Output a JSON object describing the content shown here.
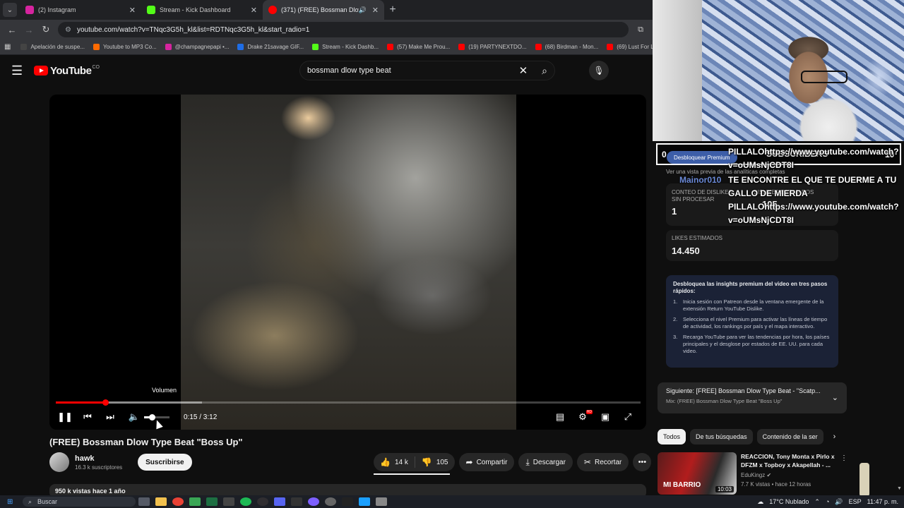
{
  "browser": {
    "tabs": [
      {
        "title": "(2) Instagram",
        "favicon_color": "#d6249f",
        "active": false
      },
      {
        "title": "Stream - Kick Dashboard",
        "favicon_color": "#53fc18",
        "active": false
      },
      {
        "title": "(371) (FREE) Bossman Dlow",
        "favicon_color": "#ff0000",
        "active": true
      }
    ],
    "url": "youtube.com/watch?v=TNqc3G5h_kl&list=RDTNqc3G5h_kl&start_radio=1",
    "bookmarks": [
      {
        "label": "Apelación de suspe...",
        "color": "#444444"
      },
      {
        "label": "Youtube to MP3 Co...",
        "color": "#ff6a00"
      },
      {
        "label": "@champagnepapi •...",
        "color": "#d6249f"
      },
      {
        "label": "Drake 21savage GIF...",
        "color": "#1e6de6"
      },
      {
        "label": "Stream - Kick Dashb...",
        "color": "#53fc18"
      },
      {
        "label": "(57) Make Me Prou...",
        "color": "#ff0000"
      },
      {
        "label": "(19) PARTYNEXTDO...",
        "color": "#ff0000"
      },
      {
        "label": "(68) Birdman - Mon...",
        "color": "#ff0000"
      },
      {
        "label": "(69) Lust For L",
        "color": "#ff0000"
      }
    ]
  },
  "youtube": {
    "logo_text": "YouTube",
    "logo_country": "CO",
    "search_value": "bossman dlow type beat"
  },
  "player": {
    "tooltip": "Volumen",
    "time": "0:15 / 3:12",
    "progress": 0.085,
    "buffered": 0.25,
    "volume": 0.3
  },
  "video": {
    "title": "(FREE) Bossman Dlow Type Beat \"Boss Up\"",
    "channel": "hawk",
    "subscribers": "16.3 k suscriptores",
    "subscribe_label": "Suscribirse",
    "likes": "14 k",
    "dislikes": "105",
    "share_label": "Compartir",
    "download_label": "Descargar",
    "clip_label": "Recortar",
    "description_preview": "950 k vistas  hace 1 año"
  },
  "overlay": {
    "sub_count_left": "0",
    "sub_label": "SUBSCRIBERS",
    "sub_count_right": "10",
    "premium_button": "Desbloquear Premium",
    "preview_note": "Ver una vista previa de las analíticas completas",
    "chat_user": "Mainor010",
    "chat_line_1a": "PILLALOhttps://www.youtube.com/watch?",
    "chat_line_1b": "v=oUMsNjCDT8I",
    "chat_line_2a": "TE ENCONTRE EL QUE TE DUERME A TU",
    "chat_line_2b": "GALLO DE MIERDA",
    "chat_line_2c": "PILLALOhttps://www.youtube.com/watch?",
    "chat_line_2d": "v=oUMsNjCDT8I"
  },
  "rydl": {
    "raw_dislikes_label": "CONTEO DE DISLIKES SIN PROCESAR",
    "raw_dislikes_value": "1",
    "est_dislikes_label": "DISLIKES ESTIMADOS",
    "est_dislikes_value": "105",
    "est_likes_label": "LIKES ESTIMADOS",
    "est_likes_value": "14.450",
    "insights_title": "Desbloquea las insights premium del video en tres pasos rápidos:",
    "steps": [
      {
        "n": "1.",
        "text": "Inicia sesión con Patreon desde la ventana emergente de la extensión Return YouTube Dislike."
      },
      {
        "n": "2.",
        "text": "Selecciona el nivel Premium para activar las líneas de tiempo de actividad, los rankings por país y el mapa interactivo."
      },
      {
        "n": "3.",
        "text": "Recarga YouTube para ver las tendencias por hora, los países principales y el desglose por estados de EE. UU. para cada video."
      }
    ]
  },
  "next": {
    "title": "Siguiente: [FREE] Bossman Dlow Type Beat - \"Scatp...",
    "subtitle": "Mix: (FREE) Bossman Dlow Type Beat \"Boss Up\""
  },
  "chips": [
    "Todos",
    "De tus búsquedas",
    "Contenido de la ser"
  ],
  "recommendation": {
    "title": "REACCION, Tony Monta x Pirlo x DFZM x Topboy x Akapellah - ...",
    "channel": "EduKingz",
    "meta": "7.7 K vistas • hace 12 horas",
    "duration": "10:03",
    "thumb_text": "MI BARRIO"
  },
  "taskbar": {
    "search": "Buscar",
    "weather": "17°C  Nublado",
    "lang": "ESP",
    "clock": "11:47 p. m."
  }
}
